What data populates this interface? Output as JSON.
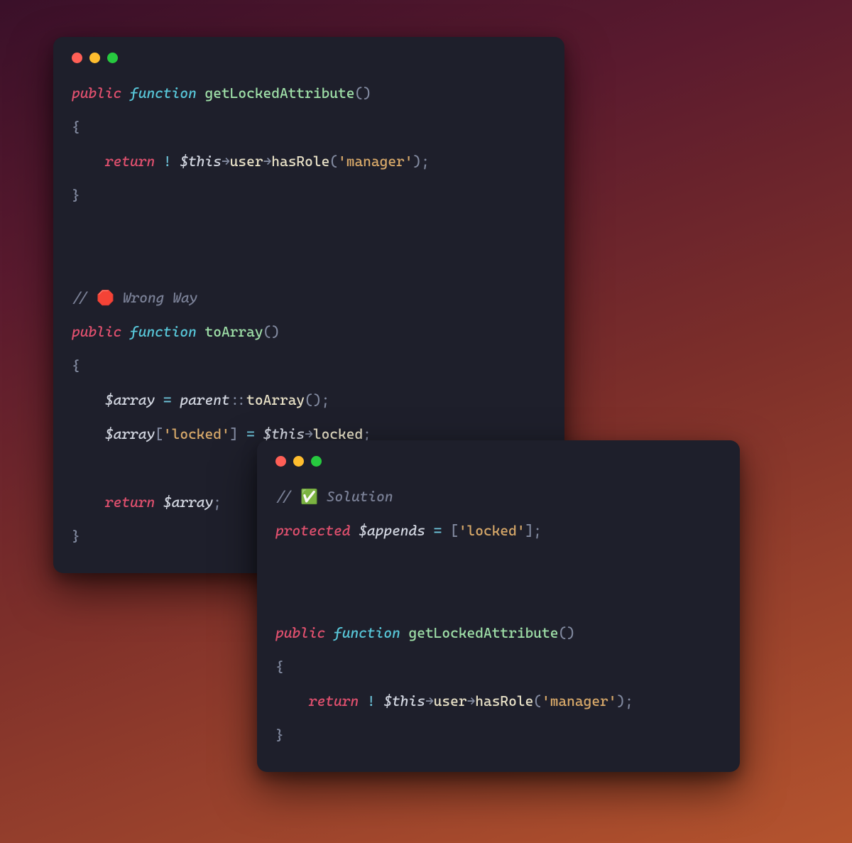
{
  "window1": {
    "block1": {
      "kw_public": "public",
      "kw_function": "function",
      "fn_name": "getLockedAttribute",
      "parens": "()",
      "brace_open": "{",
      "kw_return": "return",
      "op_not": "!",
      "var_this": "$this",
      "arrow1": "→",
      "prop_user": "user",
      "arrow2": "→",
      "fn_hasRole": "hasRole",
      "paren_open": "(",
      "str_manager": "'manager'",
      "paren_close_semi": ");",
      "brace_close": "}"
    },
    "comment": {
      "slashes": "//",
      "emoji": "🛑",
      "text": "Wrong Way"
    },
    "block2": {
      "kw_public": "public",
      "kw_function": "function",
      "fn_name": "toArray",
      "parens": "()",
      "brace_open": "{",
      "var_array_a": "$array",
      "op_eq": "=",
      "var_parent": "parent",
      "dcolon": "::",
      "fn_toArray": "toArray",
      "call_semi": "();",
      "var_array_b": "$array",
      "bracket_open": "[",
      "str_locked": "'locked'",
      "bracket_close": "]",
      "op_eq2": "=",
      "var_this": "$this",
      "arrow": "→",
      "prop_locked": "locked",
      "semi": ";",
      "kw_return": "return",
      "var_array_c": "$array",
      "semi2": ";",
      "brace_close": "}"
    }
  },
  "window2": {
    "comment": {
      "slashes": "//",
      "emoji": "✅",
      "text": "Solution"
    },
    "appends": {
      "kw_protected": "protected",
      "var_appends": "$appends",
      "op_eq": "=",
      "bracket_open": "[",
      "str_locked": "'locked'",
      "bracket_close_semi": "];"
    },
    "block": {
      "kw_public": "public",
      "kw_function": "function",
      "fn_name": "getLockedAttribute",
      "parens": "()",
      "brace_open": "{",
      "kw_return": "return",
      "op_not": "!",
      "var_this": "$this",
      "arrow1": "→",
      "prop_user": "user",
      "arrow2": "→",
      "fn_hasRole": "hasRole",
      "paren_open": "(",
      "str_manager": "'manager'",
      "paren_close_semi": ");",
      "brace_close": "}"
    }
  }
}
